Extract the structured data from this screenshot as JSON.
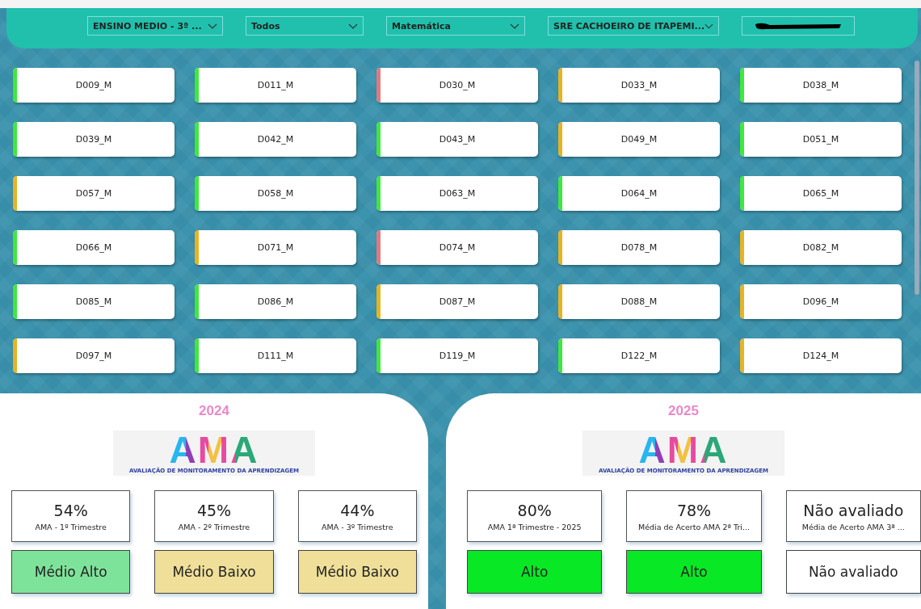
{
  "filters": [
    {
      "kind": "dropdown",
      "value": "ENSINO MEDIO - 3ª ..."
    },
    {
      "kind": "dropdown",
      "value": "Todos"
    },
    {
      "kind": "dropdown",
      "value": "Matemática"
    },
    {
      "kind": "dropdown",
      "value": "SRE CACHOEIRO DE ITAPEMI..."
    },
    {
      "kind": "redacted"
    }
  ],
  "descriptors": [
    {
      "label": "D009_M",
      "color": "#3ee83e"
    },
    {
      "label": "D011_M",
      "color": "#3ee83e"
    },
    {
      "label": "D030_M",
      "color": "#e07a80"
    },
    {
      "label": "D033_M",
      "color": "#e6b422"
    },
    {
      "label": "D038_M",
      "color": "#3ee83e"
    },
    {
      "label": "D039_M",
      "color": "#3ee83e"
    },
    {
      "label": "D042_M",
      "color": "#3ee83e"
    },
    {
      "label": "D043_M",
      "color": "#3ee83e"
    },
    {
      "label": "D049_M",
      "color": "#e6b422"
    },
    {
      "label": "D051_M",
      "color": "#3ee83e"
    },
    {
      "label": "D057_M",
      "color": "#e6b422"
    },
    {
      "label": "D058_M",
      "color": "#3ee83e"
    },
    {
      "label": "D063_M",
      "color": "#3ee83e"
    },
    {
      "label": "D064_M",
      "color": "#3ee83e"
    },
    {
      "label": "D065_M",
      "color": "#3ee83e"
    },
    {
      "label": "D066_M",
      "color": "#3ee83e"
    },
    {
      "label": "D071_M",
      "color": "#e6b422"
    },
    {
      "label": "D074_M",
      "color": "#e07a80"
    },
    {
      "label": "D078_M",
      "color": "#e6b422"
    },
    {
      "label": "D082_M",
      "color": "#e6b422"
    },
    {
      "label": "D085_M",
      "color": "#3ee83e"
    },
    {
      "label": "D086_M",
      "color": "#3ee83e"
    },
    {
      "label": "D087_M",
      "color": "#e6b422"
    },
    {
      "label": "D088_M",
      "color": "#e6b422"
    },
    {
      "label": "D096_M",
      "color": "#e6b422"
    },
    {
      "label": "D097_M",
      "color": "#e6b422"
    },
    {
      "label": "D111_M",
      "color": "#3ee83e"
    },
    {
      "label": "D119_M",
      "color": "#3ee83e"
    },
    {
      "label": "D122_M",
      "color": "#3ee83e"
    },
    {
      "label": "D124_M",
      "color": "#e6b422"
    }
  ],
  "panels": [
    {
      "year": "2024",
      "logo": {
        "text": "AMA",
        "tagline": "AVALIAÇÃO DE MONITORAMENTO DA APRENDIZAGEM"
      },
      "cards": [
        {
          "value": "54%",
          "label": "AMA - 1º Trimestre",
          "level": "Médio Alto",
          "color": "#7ee39a"
        },
        {
          "value": "45%",
          "label": "AMA - 2º Trimestre",
          "level": "Médio Baixo",
          "color": "#efdf98"
        },
        {
          "value": "44%",
          "label": "AMA - 3º Trimestre",
          "level": "Médio Baixo",
          "color": "#efdf98"
        }
      ]
    },
    {
      "year": "2025",
      "logo": {
        "text": "AMA",
        "tagline": "AVALIAÇÃO DE MONITORAMENTO DA APRENDIZAGEM"
      },
      "cards": [
        {
          "value": "80%",
          "label": "AMA 1ª Trimestre - 2025",
          "level": "Alto",
          "color": "#08e825"
        },
        {
          "value": "78%",
          "label": "Média de Acerto AMA 2ª Tri...",
          "level": "Alto",
          "color": "#08e825"
        },
        {
          "value": "Não avaliado",
          "label": "Média de Acerto AMA 3ª ...",
          "level": "Não avaliado",
          "color": "#ffffff"
        }
      ]
    }
  ]
}
